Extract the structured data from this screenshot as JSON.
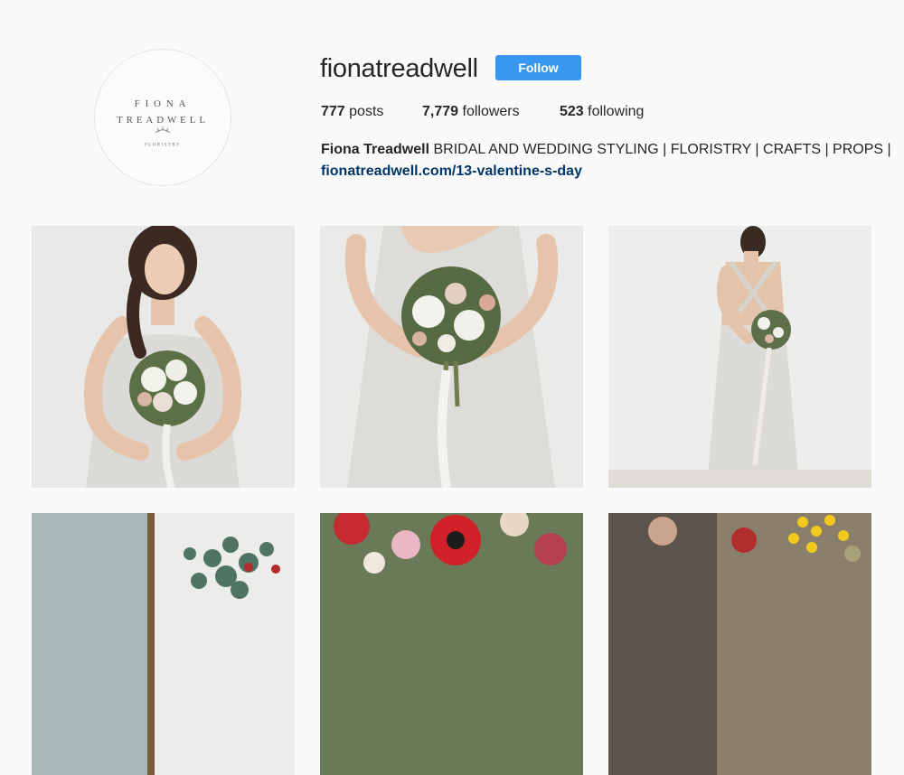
{
  "profile": {
    "username": "fionatreadwell",
    "follow_label": "Follow",
    "avatar_logo_text": "FIONA TREADWELL FLORISTRY",
    "stats": {
      "posts_count": "777",
      "posts_label": "posts",
      "followers_count": "7,779",
      "followers_label": "followers",
      "following_count": "523",
      "following_label": "following"
    },
    "bio": {
      "name": "Fiona Treadwell",
      "text": " BRIDAL AND WEDDING STYLING | FLORISTRY | CRAFTS | PROPS |",
      "link": "fionatreadwell.com/13-valentine-s-day"
    }
  },
  "posts": [
    {
      "subject": "bride with braid holding bouquet"
    },
    {
      "subject": "bouquet held at waist"
    },
    {
      "subject": "bride from behind in gown"
    },
    {
      "subject": "eucalyptus in window"
    },
    {
      "subject": "red anemones and flowers"
    },
    {
      "subject": "florist market stall"
    }
  ],
  "colors": {
    "accent": "#3897f0",
    "link": "#003569",
    "background": "#fafafa"
  }
}
